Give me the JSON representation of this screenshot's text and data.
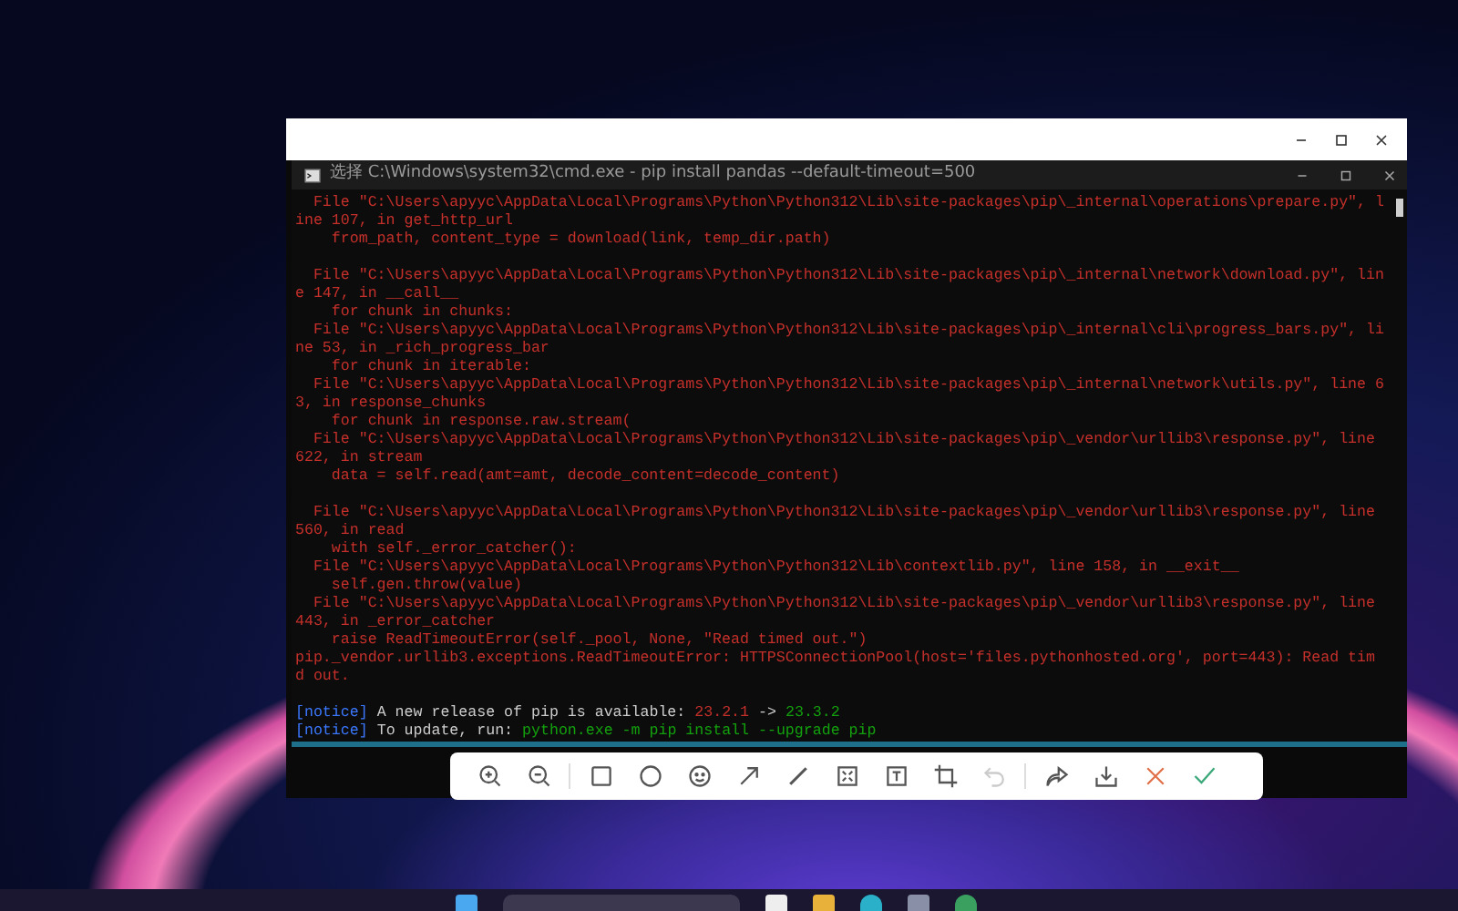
{
  "console": {
    "title": "选择 C:\\Windows\\system32\\cmd.exe - pip  install pandas --default-timeout=500",
    "lines": [
      {
        "kind": "text",
        "text": "  File \"C:\\Users\\apyyc\\AppData\\Local\\Programs\\Python\\Python312\\Lib\\site-packages\\pip\\_internal\\operations\\prepare.py\", l"
      },
      {
        "kind": "text",
        "text": "ine 107, in get_http_url"
      },
      {
        "kind": "text",
        "text": "    from_path, content_type = download(link, temp_dir.path)"
      },
      {
        "kind": "blank"
      },
      {
        "kind": "text",
        "text": "  File \"C:\\Users\\apyyc\\AppData\\Local\\Programs\\Python\\Python312\\Lib\\site-packages\\pip\\_internal\\network\\download.py\", lin"
      },
      {
        "kind": "text",
        "text": "e 147, in __call__"
      },
      {
        "kind": "text",
        "text": "    for chunk in chunks:"
      },
      {
        "kind": "text",
        "text": "  File \"C:\\Users\\apyyc\\AppData\\Local\\Programs\\Python\\Python312\\Lib\\site-packages\\pip\\_internal\\cli\\progress_bars.py\", li"
      },
      {
        "kind": "text",
        "text": "ne 53, in _rich_progress_bar"
      },
      {
        "kind": "text",
        "text": "    for chunk in iterable:"
      },
      {
        "kind": "text",
        "text": "  File \"C:\\Users\\apyyc\\AppData\\Local\\Programs\\Python\\Python312\\Lib\\site-packages\\pip\\_internal\\network\\utils.py\", line 6"
      },
      {
        "kind": "text",
        "text": "3, in response_chunks"
      },
      {
        "kind": "text",
        "text": "    for chunk in response.raw.stream("
      },
      {
        "kind": "text",
        "text": "  File \"C:\\Users\\apyyc\\AppData\\Local\\Programs\\Python\\Python312\\Lib\\site-packages\\pip\\_vendor\\urllib3\\response.py\", line"
      },
      {
        "kind": "text",
        "text": "622, in stream"
      },
      {
        "kind": "text",
        "text": "    data = self.read(amt=amt, decode_content=decode_content)"
      },
      {
        "kind": "blank"
      },
      {
        "kind": "text",
        "text": "  File \"C:\\Users\\apyyc\\AppData\\Local\\Programs\\Python\\Python312\\Lib\\site-packages\\pip\\_vendor\\urllib3\\response.py\", line"
      },
      {
        "kind": "text",
        "text": "560, in read"
      },
      {
        "kind": "text",
        "text": "    with self._error_catcher():"
      },
      {
        "kind": "text",
        "text": "  File \"C:\\Users\\apyyc\\AppData\\Local\\Programs\\Python\\Python312\\Lib\\contextlib.py\", line 158, in __exit__"
      },
      {
        "kind": "text",
        "text": "    self.gen.throw(value)"
      },
      {
        "kind": "text",
        "text": "  File \"C:\\Users\\apyyc\\AppData\\Local\\Programs\\Python\\Python312\\Lib\\site-packages\\pip\\_vendor\\urllib3\\response.py\", line"
      },
      {
        "kind": "text",
        "text": "443, in _error_catcher"
      },
      {
        "kind": "text",
        "text": "    raise ReadTimeoutError(self._pool, None, \"Read timed out.\")"
      },
      {
        "kind": "text",
        "text": "pip._vendor.urllib3.exceptions.ReadTimeoutError: HTTPSConnectionPool(host='files.pythonhosted.org', port=443): Read tim"
      },
      {
        "kind": "text",
        "text": "d out."
      },
      {
        "kind": "blank"
      },
      {
        "kind": "notice",
        "segments": [
          {
            "kind": "tag",
            "text": "[notice]"
          },
          {
            "kind": "plain",
            "text": "A new release of pip is available:"
          },
          {
            "kind": "old",
            "text": "23.2.1"
          },
          {
            "kind": "plain",
            "text": "->"
          },
          {
            "kind": "new",
            "text": "23.3.2"
          }
        ]
      },
      {
        "kind": "notice",
        "segments": [
          {
            "kind": "tag",
            "text": "[notice]"
          },
          {
            "kind": "plain",
            "text": "To update, run:"
          },
          {
            "kind": "new",
            "text": "python.exe -m pip install --upgrade pip"
          }
        ]
      }
    ]
  },
  "toolbar": [
    {
      "kind": "zoom-in",
      "disabled": false
    },
    {
      "kind": "zoom-out",
      "disabled": false
    },
    {
      "kind": "separator"
    },
    {
      "kind": "rectangle",
      "disabled": false
    },
    {
      "kind": "circle",
      "disabled": false
    },
    {
      "kind": "emoji",
      "disabled": false
    },
    {
      "kind": "arrow",
      "disabled": false
    },
    {
      "kind": "pen",
      "disabled": false
    },
    {
      "kind": "mosaic",
      "disabled": false
    },
    {
      "kind": "text",
      "disabled": false
    },
    {
      "kind": "crop",
      "disabled": false
    },
    {
      "kind": "undo",
      "disabled": true
    },
    {
      "kind": "separator"
    },
    {
      "kind": "share",
      "disabled": false
    },
    {
      "kind": "download",
      "disabled": false
    },
    {
      "kind": "cancel",
      "disabled": false
    },
    {
      "kind": "confirm",
      "disabled": false
    }
  ]
}
